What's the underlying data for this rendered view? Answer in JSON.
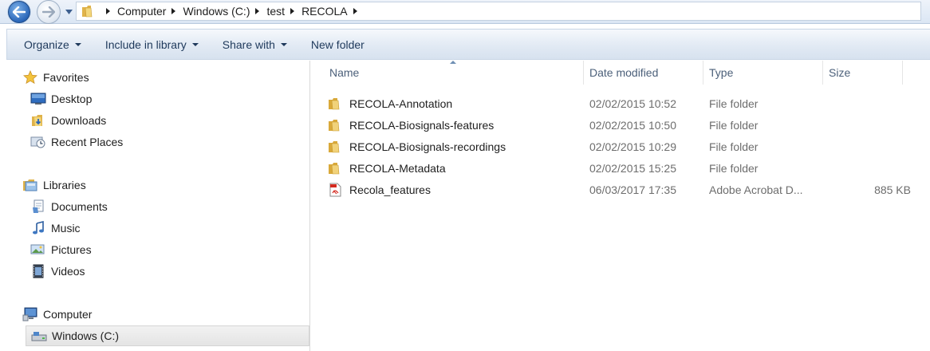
{
  "address": {
    "crumbs": [
      "Computer",
      "Windows (C:)",
      "test",
      "RECOLA"
    ]
  },
  "toolbar": {
    "organize": "Organize",
    "include_in_library": "Include in library",
    "share_with": "Share with",
    "new_folder": "New folder"
  },
  "navpane": {
    "favorites": {
      "label": "Favorites",
      "items": [
        "Desktop",
        "Downloads",
        "Recent Places"
      ]
    },
    "libraries": {
      "label": "Libraries",
      "items": [
        "Documents",
        "Music",
        "Pictures",
        "Videos"
      ]
    },
    "computer": {
      "label": "Computer",
      "items": [
        "Windows (C:)"
      ]
    }
  },
  "filelist": {
    "columns": [
      "Name",
      "Date modified",
      "Type",
      "Size"
    ],
    "rows": [
      {
        "name": "RECOLA-Annotation",
        "date": "02/02/2015 10:52",
        "type": "File folder",
        "size": "",
        "icon": "folder-icon"
      },
      {
        "name": "RECOLA-Biosignals-features",
        "date": "02/02/2015 10:50",
        "type": "File folder",
        "size": "",
        "icon": "folder-icon"
      },
      {
        "name": "RECOLA-Biosignals-recordings",
        "date": "02/02/2015 10:29",
        "type": "File folder",
        "size": "",
        "icon": "folder-icon"
      },
      {
        "name": "RECOLA-Metadata",
        "date": "02/02/2015 15:25",
        "type": "File folder",
        "size": "",
        "icon": "folder-icon"
      },
      {
        "name": "Recola_features",
        "date": "06/03/2017 17:35",
        "type": "Adobe Acrobat D...",
        "size": "885 KB",
        "icon": "pdf-icon"
      }
    ]
  },
  "colors": {
    "accent": "#2a66b8",
    "folder": "#e9c15a",
    "pdf": "#d42a20",
    "header_text": "#4c607a"
  }
}
